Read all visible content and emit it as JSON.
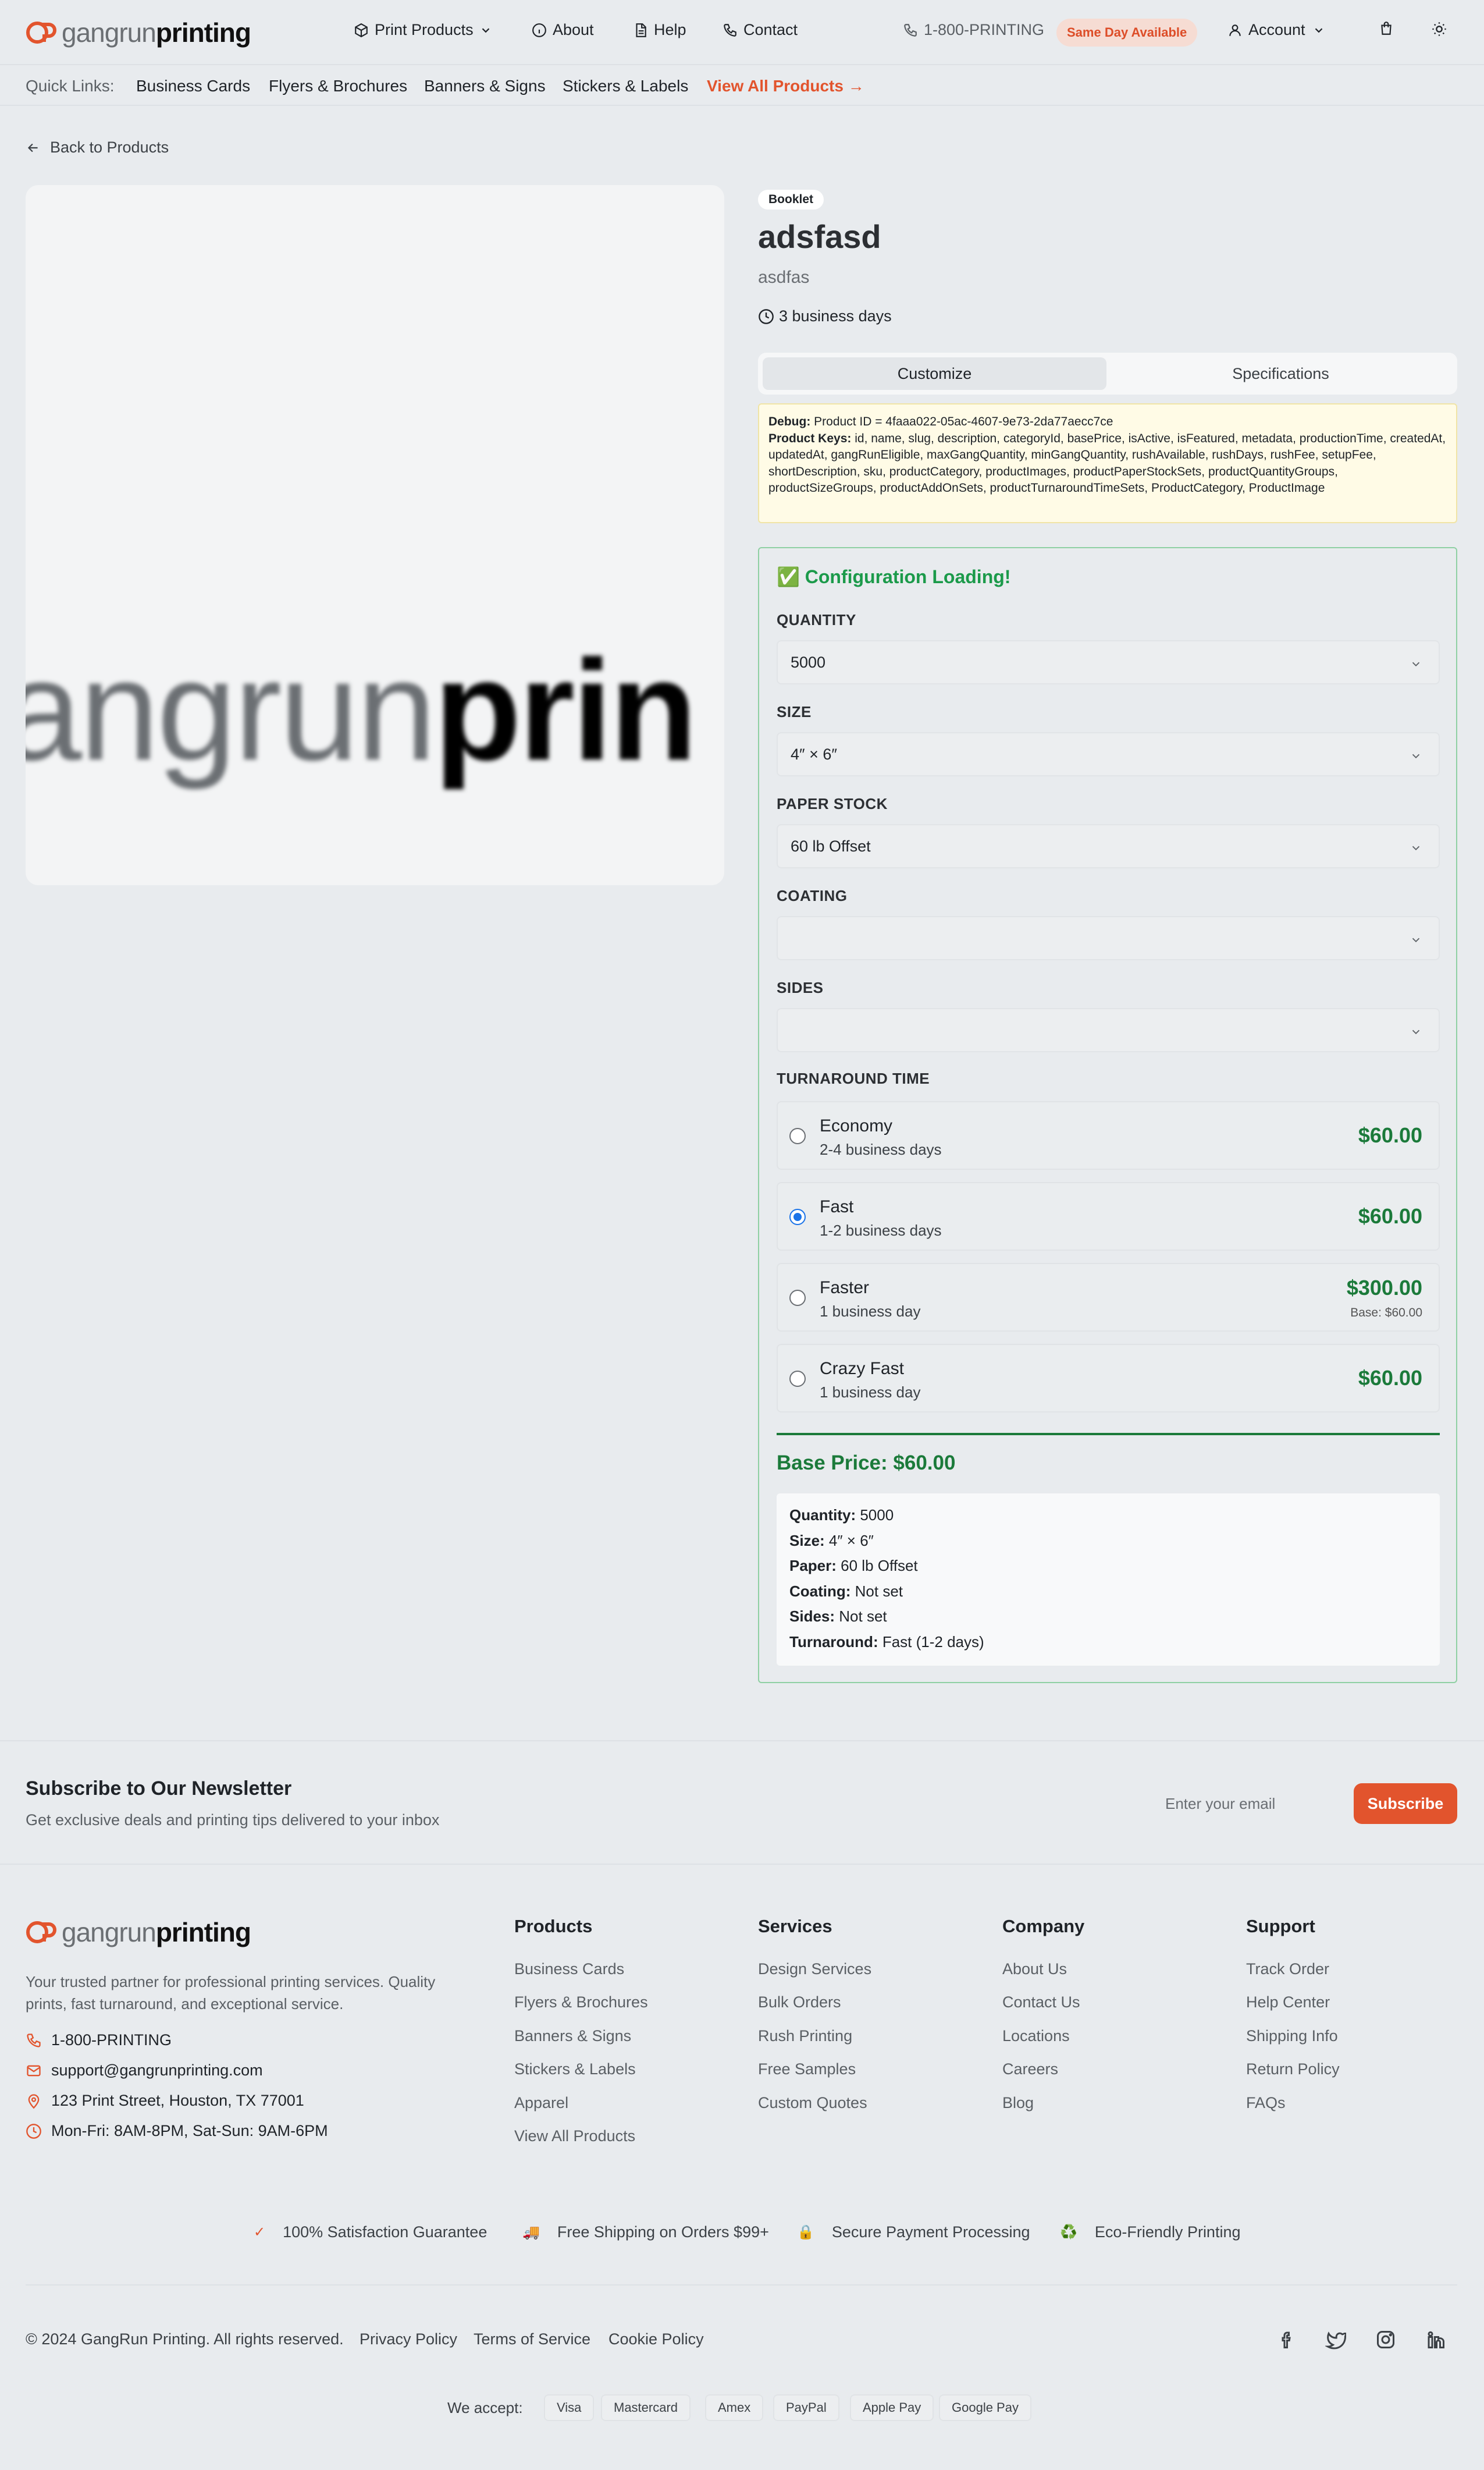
{
  "header": {
    "logo_light": "gangrun",
    "logo_bold": "printing",
    "nav": {
      "print_products": "Print Products",
      "about": "About",
      "help": "Help",
      "contact": "Contact"
    },
    "phone": "1-800-PRINTING",
    "badge": "Same Day Available",
    "account": "Account"
  },
  "quick_links": {
    "label": "Quick Links:",
    "items": [
      "Business Cards",
      "Flyers & Brochures",
      "Banners & Signs",
      "Stickers & Labels"
    ],
    "view_all": "View All Products →"
  },
  "back_link": "Back to Products",
  "product_image": {
    "text_light": "angrun",
    "text_bold": "prin"
  },
  "product": {
    "category": "Booklet",
    "title": "adsfasd",
    "subtitle": "asdfas",
    "turnaround": "3 business days"
  },
  "tabs": [
    "Customize",
    "Specifications"
  ],
  "debug": {
    "label": "Debug:",
    "product_id": "Product ID = 4faaa022-05ac-4607-9e73-2da77aecc7ce",
    "keys_label": "Product Keys:",
    "keys": "id, name, slug, description, categoryId, basePrice, isActive, isFeatured, metadata, productionTime, createdAt, updatedAt, gangRunEligible, maxGangQuantity, minGangQuantity, rushAvailable, rushDays, rushFee, setupFee, shortDescription, sku, productCategory, productImages, productPaperStockSets, productQuantityGroups, productSizeGroups, productAddOnSets, productTurnaroundTimeSets, ProductCategory, ProductImage"
  },
  "config": {
    "heading": "✅ Configuration Loading!",
    "quantity_label": "QUANTITY",
    "quantity_value": "5000",
    "size_label": "SIZE",
    "size_value": "4″ × 6″",
    "paper_label": "PAPER STOCK",
    "paper_value": "60 lb Offset",
    "coating_label": "COATING",
    "coating_value": "",
    "sides_label": "SIDES",
    "sides_value": "",
    "turnaround_label": "TURNAROUND TIME",
    "turnaround_options": [
      {
        "name": "Economy",
        "days": "2-4 business days",
        "price": "$60.00",
        "base": "",
        "selected": false
      },
      {
        "name": "Fast",
        "days": "1-2 business days",
        "price": "$60.00",
        "base": "",
        "selected": true
      },
      {
        "name": "Faster",
        "days": "1 business day",
        "price": "$300.00",
        "base": "Base: $60.00",
        "selected": false
      },
      {
        "name": "Crazy Fast",
        "days": "1 business day",
        "price": "$60.00",
        "base": "",
        "selected": false
      }
    ],
    "base_price": "Base Price: $60.00",
    "summary": [
      {
        "label": "Quantity:",
        "value": "5000"
      },
      {
        "label": "Size:",
        "value": "4″ × 6″"
      },
      {
        "label": "Paper:",
        "value": "60 lb Offset"
      },
      {
        "label": "Coating:",
        "value": "Not set"
      },
      {
        "label": "Sides:",
        "value": "Not set"
      },
      {
        "label": "Turnaround:",
        "value": "Fast (1-2 days)"
      }
    ]
  },
  "newsletter": {
    "title": "Subscribe to Our Newsletter",
    "subtitle": "Get exclusive deals and printing tips delivered to your inbox",
    "placeholder": "Enter your email",
    "button": "Subscribe"
  },
  "footer": {
    "description": "Your trusted partner for professional printing services. Quality prints, fast turnaround, and exceptional service.",
    "contact": {
      "phone": "1-800-PRINTING",
      "email": "support@gangrunprinting.com",
      "address": "123 Print Street, Houston, TX 77001",
      "hours": "Mon-Fri: 8AM-8PM, Sat-Sun: 9AM-6PM"
    },
    "columns": [
      {
        "title": "Products",
        "links": [
          "Business Cards",
          "Flyers & Brochures",
          "Banners & Signs",
          "Stickers & Labels",
          "Apparel",
          "View All Products"
        ]
      },
      {
        "title": "Services",
        "links": [
          "Design Services",
          "Bulk Orders",
          "Rush Printing",
          "Free Samples",
          "Custom Quotes"
        ]
      },
      {
        "title": "Company",
        "links": [
          "About Us",
          "Contact Us",
          "Locations",
          "Careers",
          "Blog"
        ]
      },
      {
        "title": "Support",
        "links": [
          "Track Order",
          "Help Center",
          "Shipping Info",
          "Return Policy",
          "FAQs"
        ]
      }
    ],
    "trust": [
      {
        "icon": "✓",
        "text": "100% Satisfaction Guarantee"
      },
      {
        "icon": "🚚",
        "text": "Free Shipping on Orders $99+"
      },
      {
        "icon": "🔒",
        "text": "Secure Payment Processing"
      },
      {
        "icon": "♻️",
        "text": "Eco-Friendly Printing"
      }
    ],
    "copyright": "© 2024 GangRun Printing. All rights reserved.",
    "legal": [
      "Privacy Policy",
      "Terms of Service",
      "Cookie Policy"
    ],
    "accept_label": "We accept:",
    "payments": [
      "Visa",
      "Mastercard",
      "Amex",
      "PayPal",
      "Apple Pay",
      "Google Pay"
    ]
  },
  "colors": {
    "brand_orange": "#e2542d",
    "price_green": "#1b7a3a",
    "background": "#e8ebee"
  }
}
